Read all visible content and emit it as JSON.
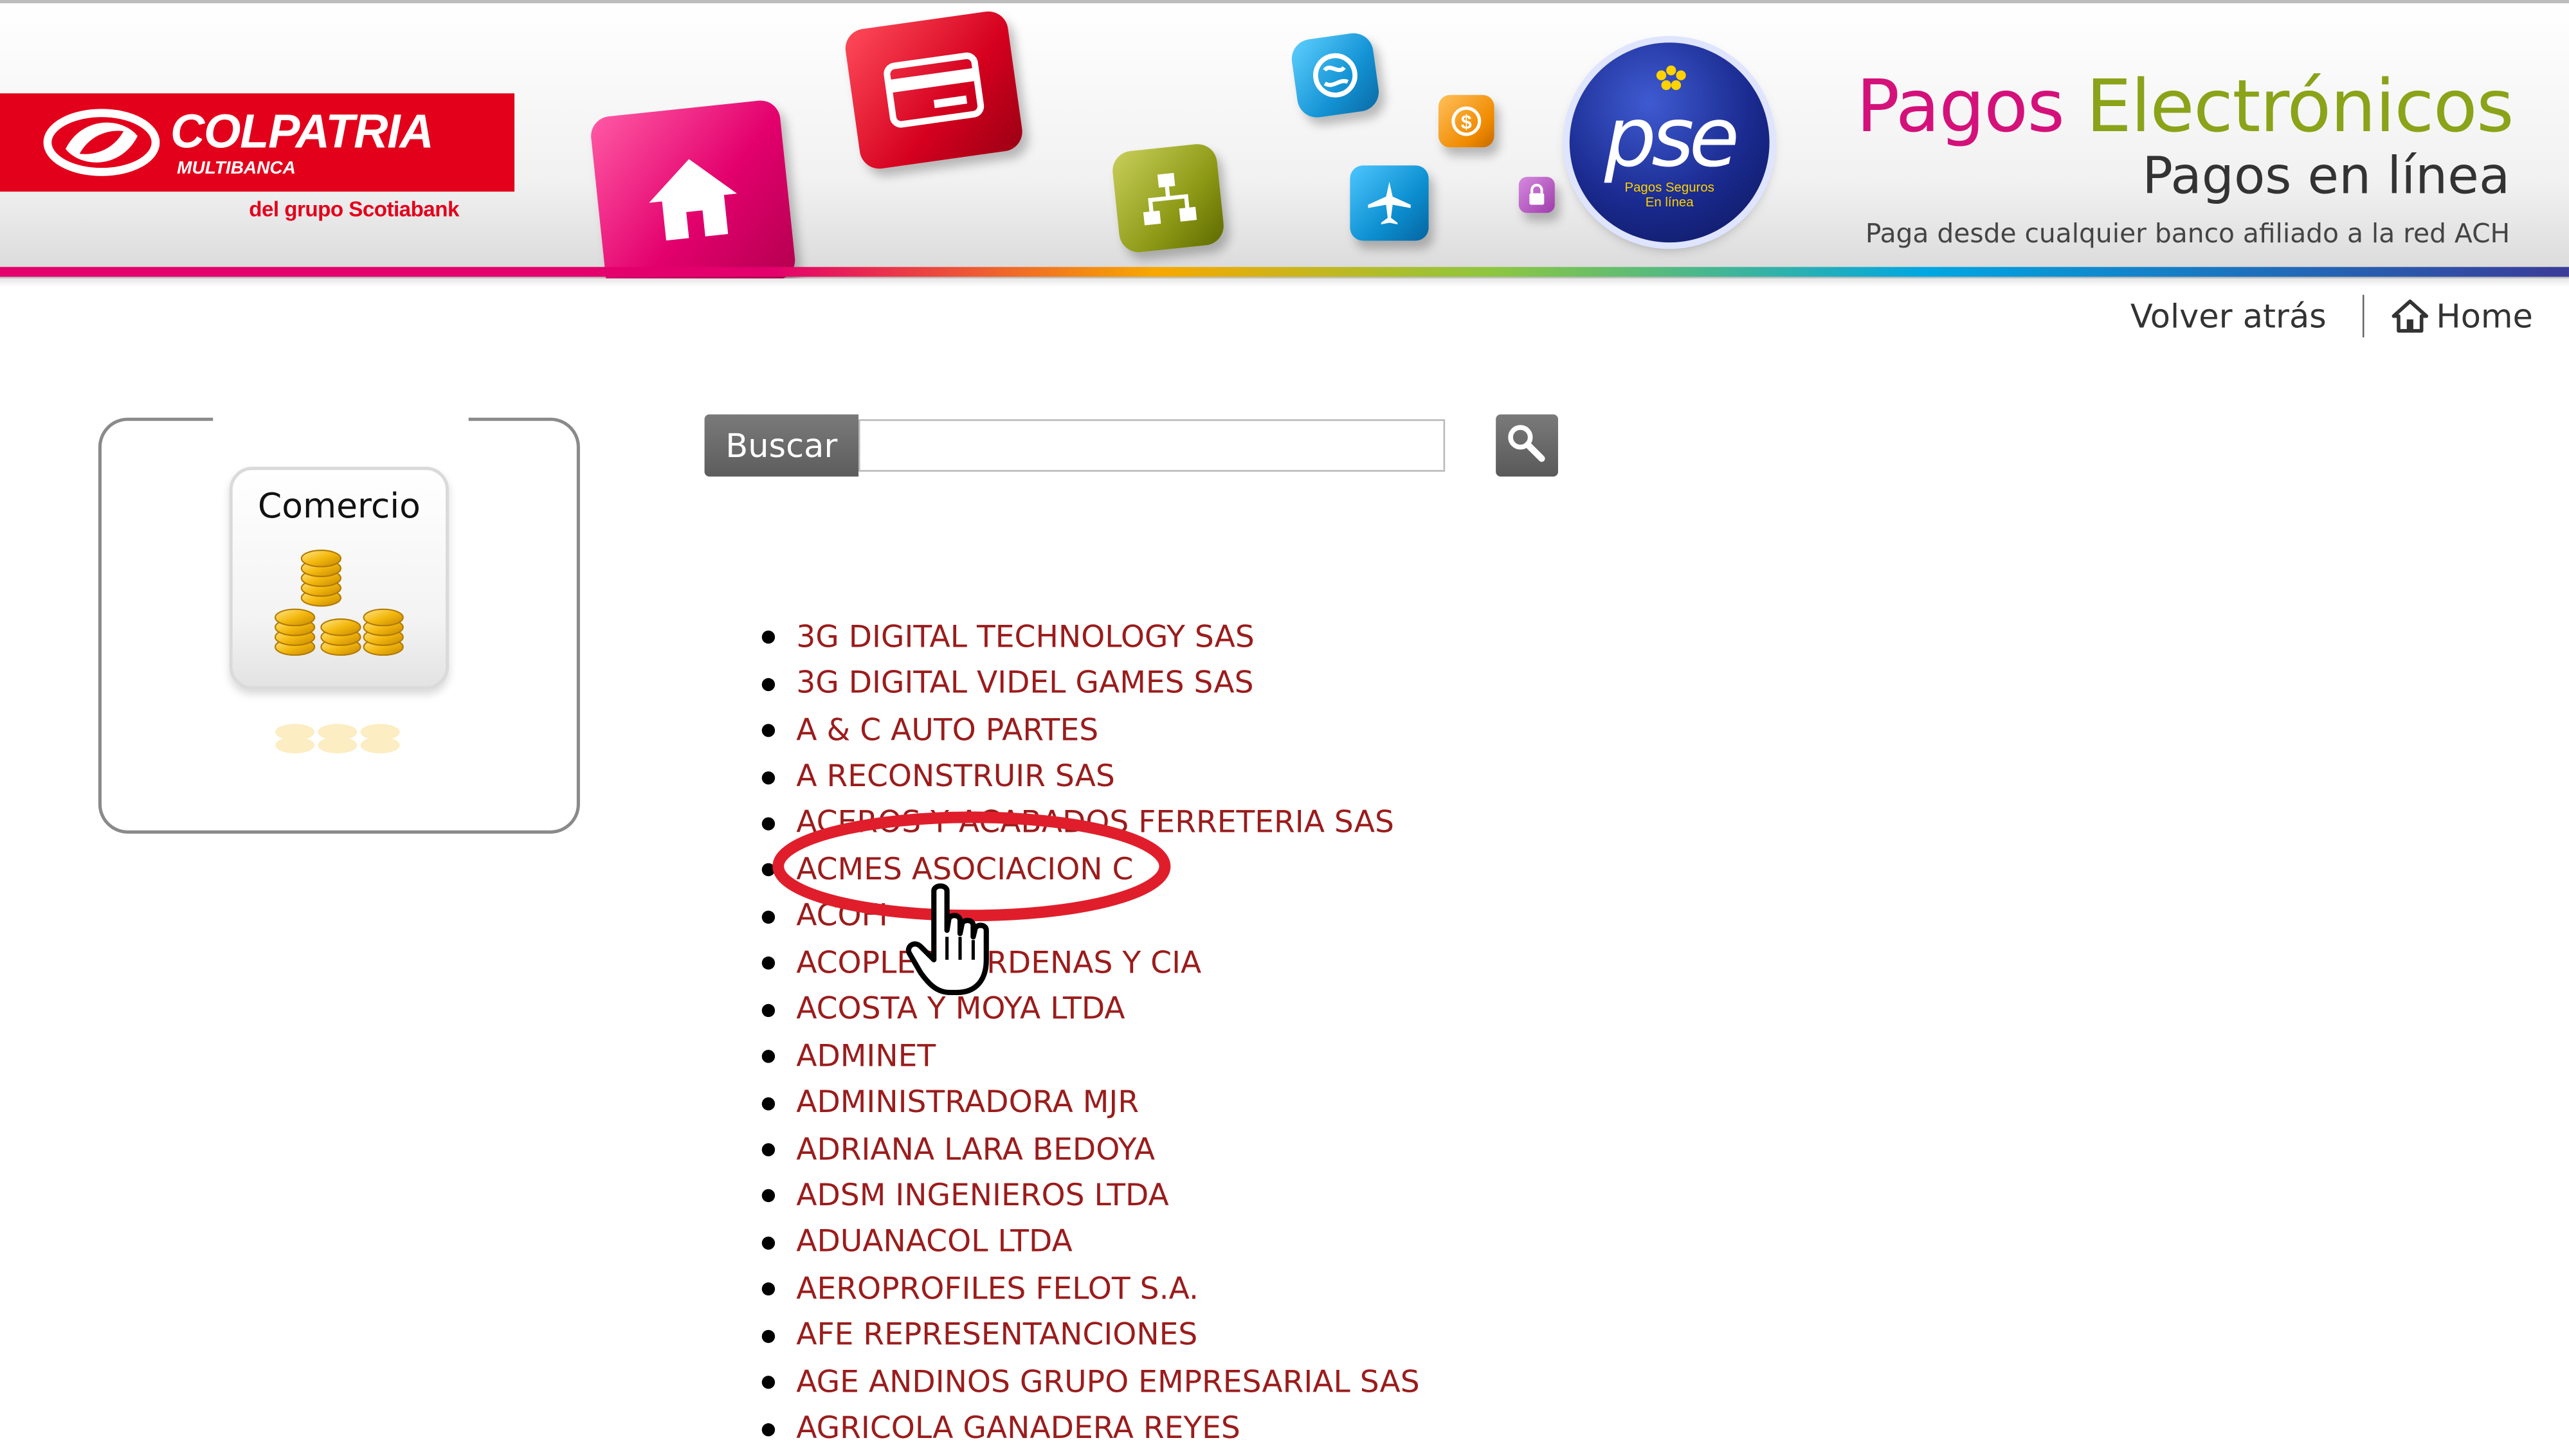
{
  "header": {
    "bank_name": "COLPATRIA",
    "bank_subline": "MULTIBANCA",
    "group_line": "del grupo Scotiabank",
    "title_part1": "Pagos ",
    "title_part2": "Electrónicos",
    "subtitle": "Pagos en línea",
    "tagline": "Paga desde cualquier banco afiliado a la red ACH",
    "pse_logo_text": "pse",
    "pse_logo_sub1": "Pagos Seguros",
    "pse_logo_sub2": "En línea"
  },
  "nav": {
    "back_label": "Volver atrás",
    "home_label": "Home"
  },
  "category": {
    "label": "Comercio"
  },
  "search": {
    "label": "Buscar",
    "value": ""
  },
  "merchants": [
    "3G DIGITAL TECHNOLOGY SAS",
    "3G DIGITAL VIDEL GAMES SAS",
    "A & C AUTO PARTES",
    "A RECONSTRUIR SAS",
    "ACEROS Y ACABADOS FERRETERIA SAS",
    "ACMES ASOCIACION C",
    "ACOFI",
    "ACOPLES CARDENAS Y CIA",
    "ACOSTA Y MOYA LTDA",
    "ADMINET",
    "ADMINISTRADORA MJR",
    "ADRIANA LARA BEDOYA",
    "ADSM INGENIEROS LTDA",
    "ADUANACOL LTDA",
    "AEROPROFILES FELOT S.A.",
    "AFE REPRESENTANCIONES",
    "AGE ANDINOS GRUPO EMPRESARIAL SAS",
    "AGRICOLA GANADERA REYES"
  ],
  "colors": {
    "brand_red": "#e3001b",
    "link_red": "#9b1c1c",
    "title_magenta": "#d4117a",
    "title_green": "#8aa319",
    "pse_blue": "#1a2a8f",
    "highlight_red": "#e01e2b"
  },
  "icons": {
    "home_cube": "house-icon",
    "card_cube": "credit-card-icon",
    "network_cube": "network-icon",
    "globe_cube": "globe-icon",
    "plane_cube": "airplane-icon",
    "coin_cube": "dollar-coin-icon",
    "lock_cube": "lock-icon",
    "search": "magnifier-icon",
    "home_nav": "home-outline-icon",
    "category": "coins-stack-icon",
    "cursor": "hand-pointer-icon"
  }
}
